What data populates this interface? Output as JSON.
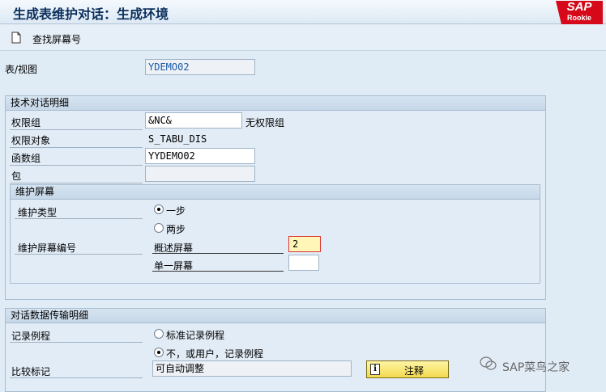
{
  "window": {
    "title": "生成表维护对话：生成环境"
  },
  "logo": {
    "line1": "SAP",
    "line2": "Rookie"
  },
  "toolbar": {
    "find_screen_label": "查找屏幕号"
  },
  "table_view": {
    "label": "表/视图",
    "value": "YDEMO02"
  },
  "tech_details": {
    "title": "技术对话明细",
    "auth_group_label": "权限组",
    "auth_group_value": "&NC&",
    "auth_group_desc": "无权限组",
    "auth_object_label": "权限对象",
    "auth_object_value": "S_TABU_DIS",
    "function_group_label": "函数组",
    "function_group_value": "YYDEMO02",
    "package_label": "包",
    "package_value": ""
  },
  "maint_screen": {
    "title": "维护屏幕",
    "type_label": "维护类型",
    "one_step_label": "一步",
    "two_step_label": "两步",
    "one_step_selected": true,
    "screen_no_label": "维护屏幕编号",
    "overview_label": "概述屏幕",
    "overview_value": "2",
    "single_label": "单一屏幕",
    "single_value": ""
  },
  "transport": {
    "title": "对话数据传输明细",
    "routine_label": "记录例程",
    "standard_routine_label": "标准记录例程",
    "no_routine_label": "不，或用户，记录例程",
    "no_routine_selected": true,
    "compare_label": "比较标记",
    "compare_value": "可自动调整",
    "note_button_label": "注释"
  },
  "watermark": {
    "text": "SAP菜鸟之家"
  },
  "colors": {
    "sap_red": "#d6091a",
    "title_blue": "#0b2f5c",
    "button_yellow": "#f2d94e"
  }
}
